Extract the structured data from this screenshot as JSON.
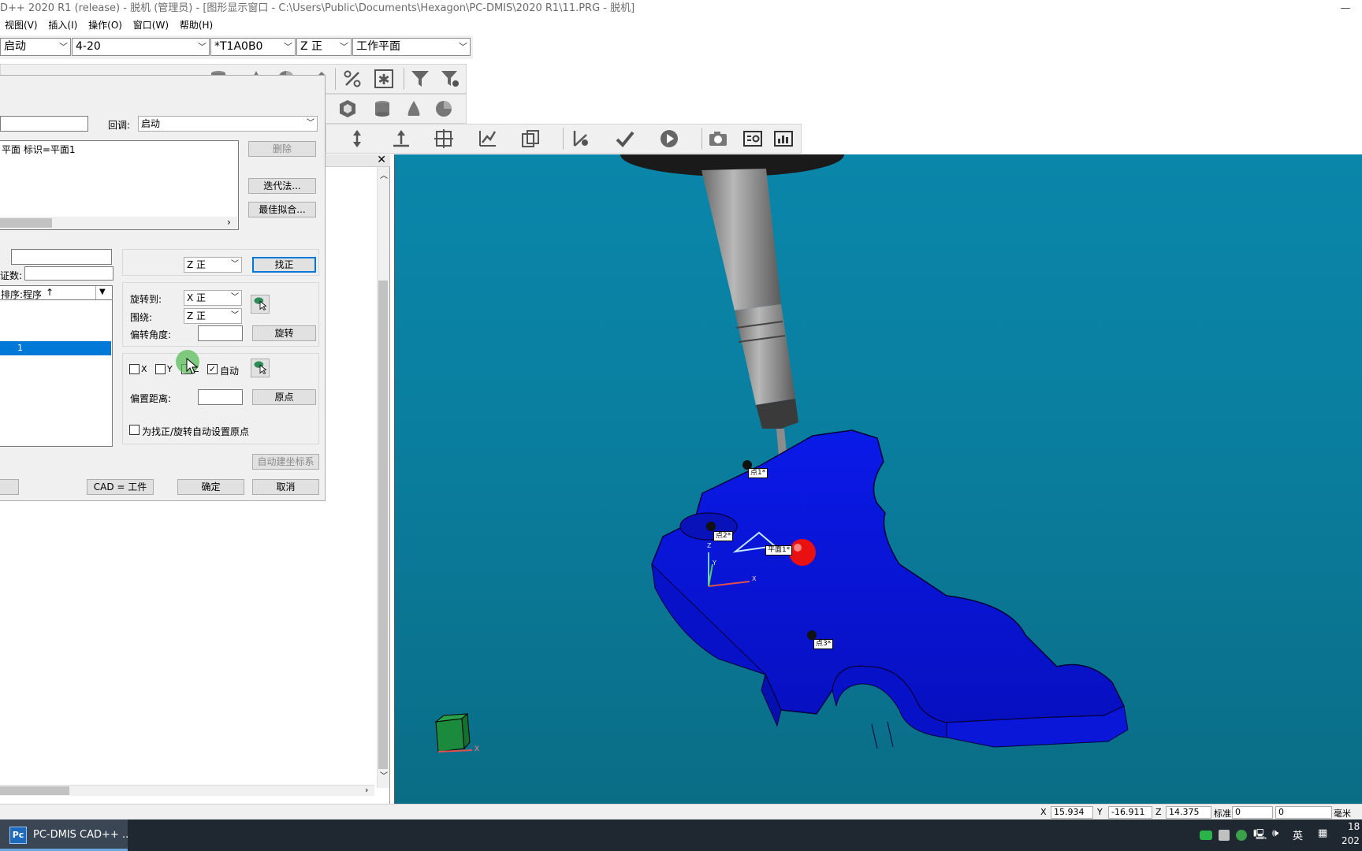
{
  "window": {
    "title": "D++ 2020 R1 (release) - 脱机 (管理员) - [图形显示窗口 - C:\\Users\\Public\\Documents\\Hexagon\\PC-DMIS\\2020 R1\\11.PRG - 脱机]",
    "minimize": "—"
  },
  "menu": [
    "视图(V)",
    "插入(I)",
    "操作(O)",
    "窗口(W)",
    "帮助(H)"
  ],
  "combos": {
    "mode": "启动",
    "probe": "4-20",
    "tip": "*T1A0B0",
    "view": "Z 正",
    "plane": "工作平面"
  },
  "dialog": {
    "recall_label": "回调:",
    "recall_value": "启动",
    "feature_list_item": "平面 标识=平面1",
    "delete_button": "删除",
    "iterative_button": "迭代法...",
    "bestfit_button": "最佳拟合...",
    "count_label": "证数:",
    "sort_label": "排序:程序",
    "sort_arrow": "↑",
    "list_selected_item": "1",
    "level_axis": "Z 正",
    "level_button": "找正",
    "rotate_to_label": "旋转到:",
    "rotate_to_value": "X 正",
    "about_label": "围绕:",
    "about_value": "Z 正",
    "offset_angle_label": "偏转角度:",
    "rotate_button": "旋转",
    "cb_x": "X",
    "cb_y": "Y",
    "cb_z": "Z",
    "cb_auto": "自动",
    "offset_dist_label": "偏置距离:",
    "origin_button": "原点",
    "auto_origin_label": "为找正/旋转自动设置原点",
    "auto_align_button": "自动建坐标系",
    "cad_button": "CAD = 工件",
    "ok_button": "确定",
    "cancel_button": "取消"
  },
  "viewport": {
    "labels": [
      "点1*",
      "点2*",
      "平面1*",
      "点3*"
    ],
    "axis_x": "X",
    "axis_y": "Y",
    "axis_z": "Z",
    "cube_axis_x": "X"
  },
  "status": {
    "x_label": "X",
    "x_value": "15.934",
    "y_label": "Y",
    "y_value": "-16.911",
    "z_label": "Z",
    "z_value": "14.375",
    "std_label": "标准",
    "std_value": "0",
    "value2": "0",
    "units": "毫米"
  },
  "taskbar": {
    "app_icon": "Pc",
    "app_label": "PC-DMIS CAD++ ...",
    "ime": "英",
    "clock_top": "18",
    "clock_bottom": "202"
  },
  "colors": {
    "part_blue": "#0a14e6",
    "viewport_top": "#0a86aa",
    "selection_blue": "#0078d7",
    "probe_ball": "#e81010"
  }
}
